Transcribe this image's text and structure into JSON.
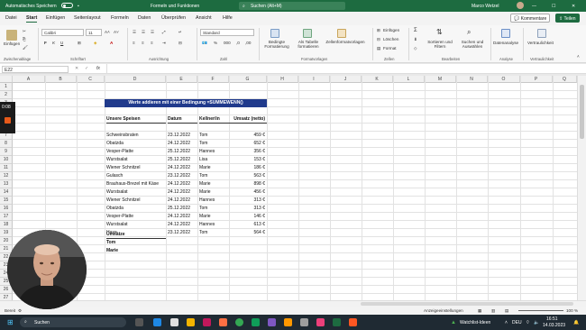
{
  "titlebar": {
    "autosave_label": "Automatisches Speichern",
    "file_name": "Formeln und Funktionen",
    "search_placeholder": "Suchen (Alt+M)",
    "user_name": "Marco Wetzel",
    "minimize": "—",
    "maximize": "☐",
    "close": "✕"
  },
  "tabs": [
    "Datei",
    "Start",
    "Einfügen",
    "Seitenlayout",
    "Formeln",
    "Daten",
    "Überprüfen",
    "Ansicht",
    "Hilfe"
  ],
  "active_tab": "Start",
  "actions": {
    "comments": "Kommentare",
    "share": "Teilen"
  },
  "ribbon": {
    "paste": "Einfügen",
    "font_name": "Calibri",
    "font_size": "11",
    "number_format": "Standard",
    "conditional": "Bedingte Formatierung",
    "as_table": "Als Tabelle formatieren",
    "cell_styles": "Zellenformatvorlagen",
    "insert": "Einfügen",
    "delete": "Löschen",
    "format": "Format",
    "sort_filter": "Sortieren und Filtern",
    "find_select": "Suchen und Auswählen",
    "data_analysis": "Datenanalyse",
    "sensitivity": "Vertraulichkeit",
    "groups": {
      "clipboard": "Zwischenablage",
      "font": "Schriftart",
      "alignment": "Ausrichtung",
      "number": "Zahl",
      "styles": "Formatvorlagen",
      "cells": "Zellen",
      "editing": "Bearbeiten",
      "analysis": "Analyse",
      "sensitivity": "Vertraulichkeit"
    }
  },
  "formula_bar": {
    "name_box": "E22",
    "fx": "fx",
    "content": ""
  },
  "columns": [
    "A",
    "B",
    "C",
    "D",
    "E",
    "F",
    "G",
    "H",
    "I",
    "J",
    "K",
    "L",
    "M",
    "N",
    "O",
    "P",
    "Q"
  ],
  "rows": [
    "1",
    "2",
    "3",
    "4",
    "5",
    "6",
    "7",
    "8",
    "9",
    "10",
    "11",
    "12",
    "13",
    "14",
    "15",
    "16",
    "17",
    "18",
    "19",
    "20",
    "21",
    "22",
    "23",
    "24",
    "25",
    "26",
    "27",
    "28",
    "29"
  ],
  "sheet": {
    "banner": "Werte addieren mit einer Bedingung  =SUMMEWENN()",
    "headers": [
      "Unsere Speisen",
      "Datum",
      "Kellner/in",
      "Umsatz (netto)"
    ],
    "data": [
      [
        "Schweinsbraten",
        "23.12.2022",
        "Tom",
        "459 €"
      ],
      [
        "Obatzda",
        "24.12.2022",
        "Tom",
        "652 €"
      ],
      [
        "Vesper-Platte",
        "25.12.2022",
        "Hannes",
        "356 €"
      ],
      [
        "Wurstsalat",
        "25.12.2022",
        "Lisa",
        "153 €"
      ],
      [
        "Wiener Schnitzel",
        "24.12.2022",
        "Marie",
        "186 €"
      ],
      [
        "Gulasch",
        "23.12.2022",
        "Tom",
        "563 €"
      ],
      [
        "Brauhaus-Brezel mit Käse",
        "24.12.2022",
        "Marie",
        "898 €"
      ],
      [
        "Wurstsalat",
        "24.12.2022",
        "Marie",
        "456 €"
      ],
      [
        "Wiener Schnitzel",
        "24.12.2022",
        "Hannes",
        "313 €"
      ],
      [
        "Obatzda",
        "25.12.2022",
        "Tom",
        "313 €"
      ],
      [
        "Vesper-Platte",
        "24.12.2022",
        "Marie",
        "146 €"
      ],
      [
        "Wurstsalat",
        "24.12.2022",
        "Hannes",
        "613 €"
      ],
      [
        "Haxe",
        "23.12.2022",
        "Tom",
        "564 €"
      ]
    ],
    "summary_label": "Umsätze",
    "summary_names": [
      "Tom",
      "Marie"
    ]
  },
  "recording": {
    "time": "0:08"
  },
  "status": {
    "ready": "Bereit",
    "display_settings": "Anzeigeeinstellungen",
    "zoom": "100 %"
  },
  "taskbar": {
    "search": "Suchen",
    "watchlist": "Watchlist-Ideen",
    "lang": "DEU",
    "time": "16:51",
    "date": "14.03.2023"
  },
  "colors": {
    "excel_green": "#1d6b40",
    "banner_blue": "#203a8c",
    "taskbar": "#1f2a33"
  }
}
